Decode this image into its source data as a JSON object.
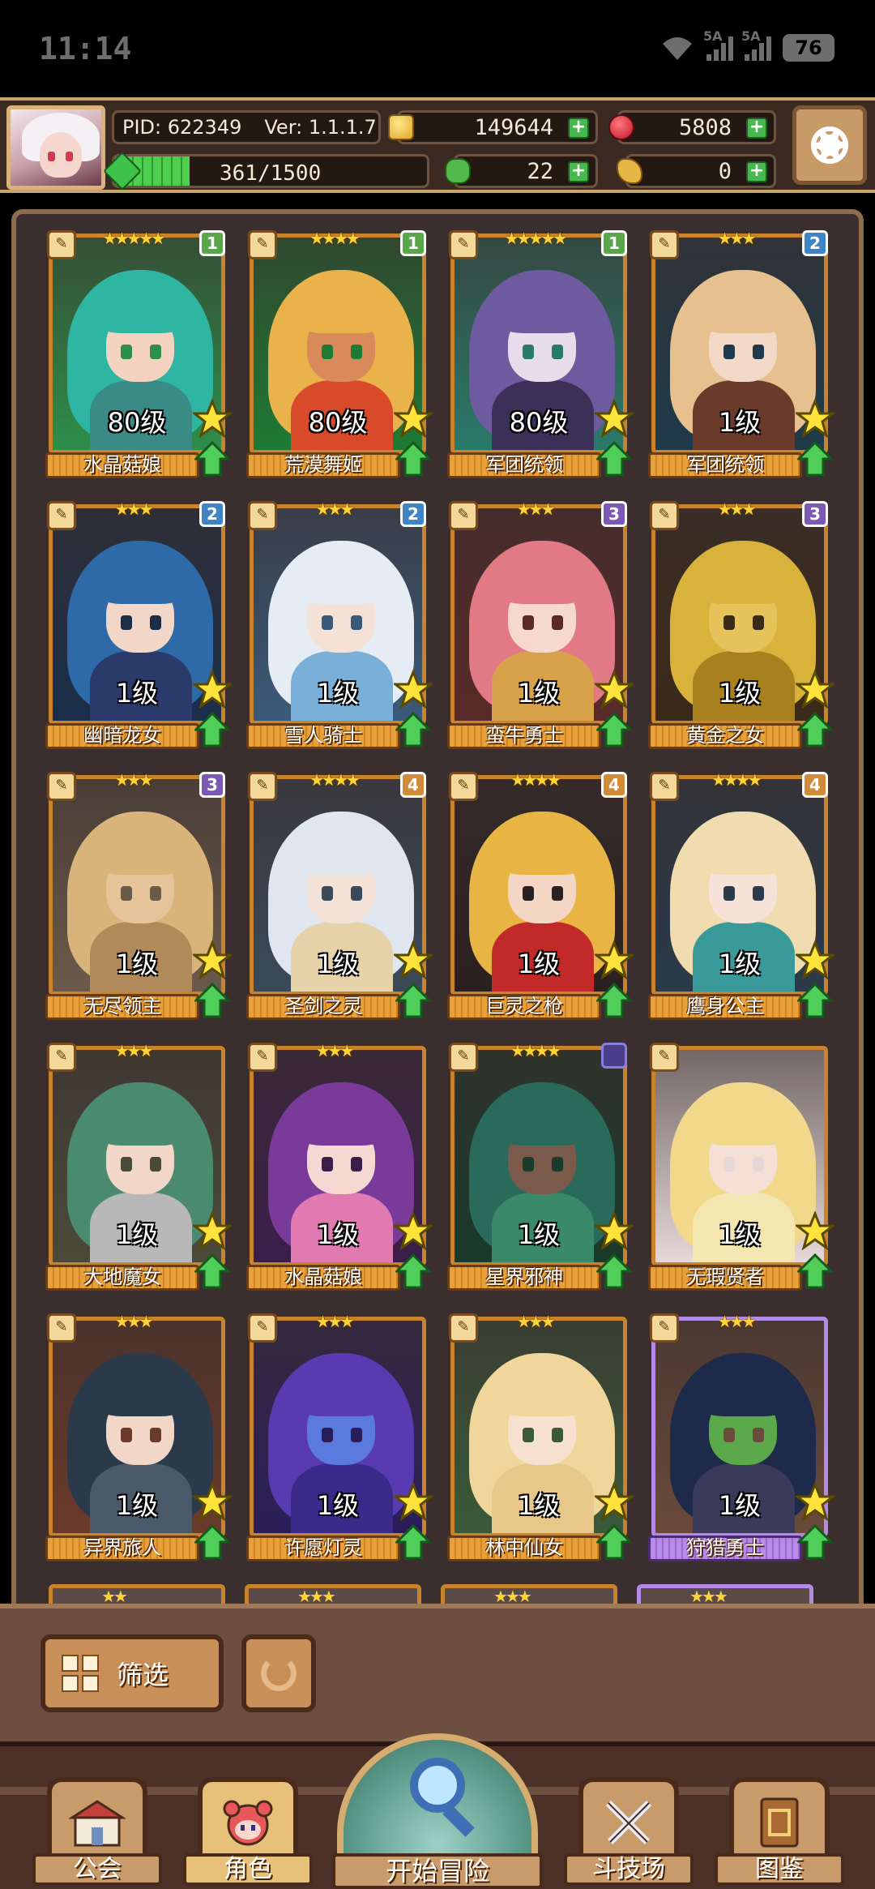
{
  "status_bar": {
    "time": "11:14",
    "network_a": "5A",
    "network_b": "5A",
    "battery": "76"
  },
  "top_bar": {
    "pid_label": "PID: 622349",
    "version_label": "Ver: 1.1.1.7",
    "gold": "149644",
    "gems": "5808",
    "stamina": "361/1500",
    "stamina_fraction": 0.24,
    "clover": "22",
    "keys": "0"
  },
  "cards": [
    {
      "stars": "★★★★★",
      "rank": "1",
      "rank_color": "g",
      "level": "80级",
      "name": "水晶菇娘",
      "palette": [
        "#2fb6a2",
        "#f3d2c2",
        "#3a8a86",
        "#2d8e4a"
      ],
      "frame": "orange"
    },
    {
      "stars": "★★★★",
      "rank": "1",
      "rank_color": "g",
      "level": "80级",
      "name": "荒漠舞姬",
      "palette": [
        "#e9b24a",
        "#d88a5a",
        "#d94a2a",
        "#1e7a34"
      ],
      "frame": "orange"
    },
    {
      "stars": "★★★★★",
      "rank": "1",
      "rank_color": "g",
      "level": "80级",
      "name": "军团统领",
      "palette": [
        "#6e5a9e",
        "#e6dcea",
        "#3a3058",
        "#2a7a6a"
      ],
      "frame": "orange"
    },
    {
      "stars": "★★★",
      "rank": "2",
      "rank_color": "b",
      "level": "1级",
      "name": "军团统领",
      "palette": [
        "#e6c08e",
        "#f2d8c6",
        "#6a3a2a",
        "#1f3a4a"
      ],
      "frame": "orange"
    },
    {
      "stars": "★★★",
      "rank": "2",
      "rank_color": "b",
      "level": "1级",
      "name": "幽暗龙女",
      "palette": [
        "#2e6aa8",
        "#f2d6c8",
        "#2a3a6a",
        "#1a2e4a"
      ],
      "frame": "orange"
    },
    {
      "stars": "★★★",
      "rank": "2",
      "rank_color": "b",
      "level": "1级",
      "name": "雪人骑士",
      "palette": [
        "#e6ecf4",
        "#f4e2d8",
        "#7ab0d8",
        "#3a5a7a"
      ],
      "frame": "orange"
    },
    {
      "stars": "★★★",
      "rank": "3",
      "rank_color": "p",
      "level": "1级",
      "name": "蛮牛勇士",
      "palette": [
        "#e27a86",
        "#f6d8ce",
        "#d8a24a",
        "#5a2a2a"
      ],
      "frame": "orange"
    },
    {
      "stars": "★★★",
      "rank": "3",
      "rank_color": "p",
      "level": "1级",
      "name": "黄金之女",
      "palette": [
        "#d8b23a",
        "#e6c25a",
        "#a8801e",
        "#3a2a18"
      ],
      "frame": "orange"
    },
    {
      "stars": "★★★",
      "rank": "3",
      "rank_color": "p",
      "level": "1级",
      "name": "无尽领主",
      "palette": [
        "#d8b47a",
        "#e6c49a",
        "#b08a5a",
        "#6a5a4a"
      ],
      "frame": "orange"
    },
    {
      "stars": "★★★★",
      "rank": "4",
      "rank_color": "o",
      "level": "1级",
      "name": "圣剑之灵",
      "palette": [
        "#dfe6f0",
        "#f4e2d8",
        "#e6d2a8",
        "#3a4a5a"
      ],
      "frame": "orange"
    },
    {
      "stars": "★★★★",
      "rank": "4",
      "rank_color": "o",
      "level": "1级",
      "name": "巨灵之枪",
      "palette": [
        "#e8b444",
        "#f4d6c4",
        "#c22a2a",
        "#2a2020"
      ],
      "frame": "orange"
    },
    {
      "stars": "★★★★",
      "rank": "4",
      "rank_color": "o",
      "level": "1级",
      "name": "鹰身公主",
      "palette": [
        "#f0dcae",
        "#f6e2d8",
        "#3a9a9a",
        "#2a3a4a"
      ],
      "frame": "orange"
    },
    {
      "stars": "★★★",
      "rank": "",
      "rank_color": "",
      "level": "1级",
      "name": "大地魔女",
      "palette": [
        "#4a8a6e",
        "#f2d6c8",
        "#b8b8b8",
        "#4a4a3a"
      ],
      "frame": "orange"
    },
    {
      "stars": "★★★",
      "rank": "",
      "rank_color": "",
      "level": "1级",
      "name": "水晶菇娘",
      "palette": [
        "#7a3a9a",
        "#f6d8d2",
        "#e07ab0",
        "#3a1e4a"
      ],
      "frame": "orange"
    },
    {
      "stars": "★★★★",
      "rank": "",
      "rank_color": "v",
      "level": "1级",
      "name": "星界邪神",
      "palette": [
        "#2a6a5a",
        "#7a5a4a",
        "#3a8a6a",
        "#1a3a2a"
      ],
      "frame": "orange"
    },
    {
      "stars": "",
      "rank": "",
      "rank_color": "",
      "level": "1级",
      "name": "无瑕贤者",
      "palette": [
        "#f2d88a",
        "#f6e0d6",
        "#f4e6b0",
        "#e6d8d8"
      ],
      "frame": "orange"
    },
    {
      "stars": "★★★",
      "rank": "",
      "rank_color": "",
      "level": "1级",
      "name": "异界旅人",
      "palette": [
        "#2a3a4a",
        "#f2d6c8",
        "#4a5a6a",
        "#6a3a2a"
      ],
      "frame": "orange"
    },
    {
      "stars": "★★★",
      "rank": "",
      "rank_color": "",
      "level": "1级",
      "name": "许愿灯灵",
      "palette": [
        "#5a3ab0",
        "#5a7ae0",
        "#3a2a8a",
        "#2a1e5a"
      ],
      "frame": "orange"
    },
    {
      "stars": "★★★",
      "rank": "",
      "rank_color": "",
      "level": "1级",
      "name": "林中仙女",
      "palette": [
        "#f0d69a",
        "#f6e0d0",
        "#e8c88a",
        "#3a5a3a"
      ],
      "frame": "orange"
    },
    {
      "stars": "★★★",
      "rank": "",
      "rank_color": "",
      "level": "1级",
      "name": "狩猎勇士",
      "palette": [
        "#1e2a4a",
        "#5aa84a",
        "#3a3a5a",
        "#6a4a3a"
      ],
      "frame": "purple"
    }
  ],
  "partial_row_stars": [
    "★★",
    "★★★",
    "★★★",
    "★★★"
  ],
  "controls": {
    "filter_label": "筛选"
  },
  "nav": {
    "guild": "公会",
    "character": "角色",
    "adventure": "开始冒险",
    "arena": "斗技场",
    "codex": "图鉴"
  }
}
